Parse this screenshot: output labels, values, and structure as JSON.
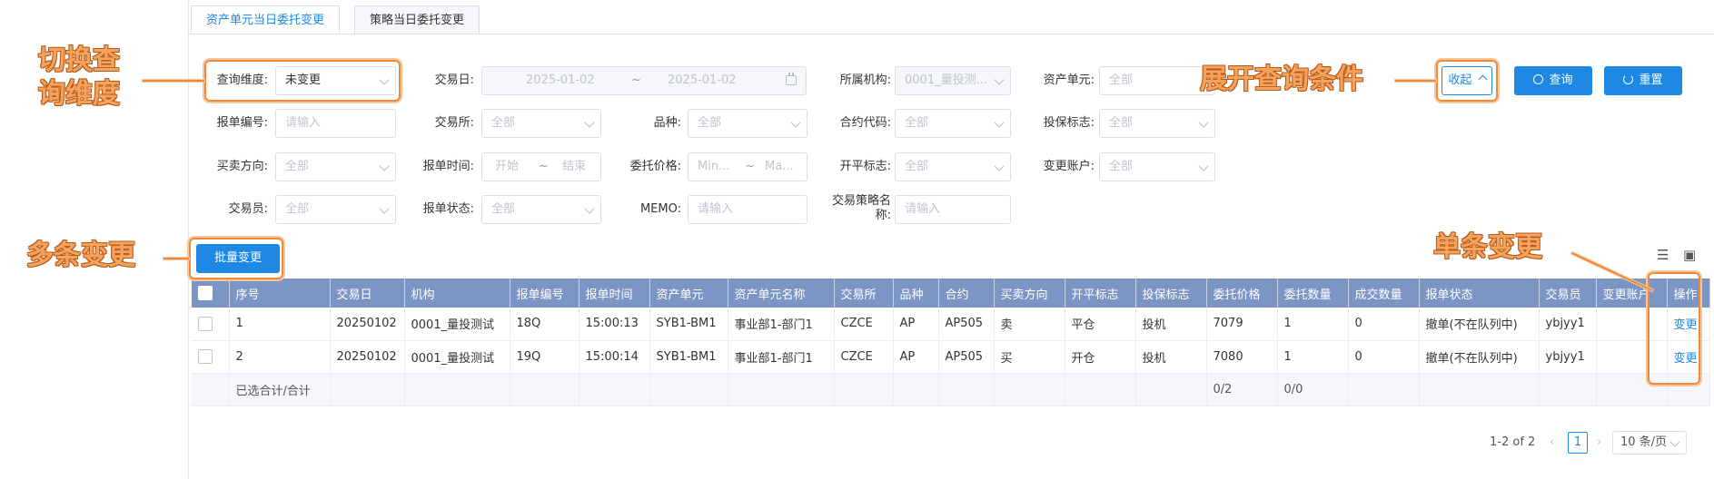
{
  "tabs": [
    {
      "label": "资产单元当日委托变更",
      "active": true
    },
    {
      "label": "策略当日委托变更",
      "active": false
    }
  ],
  "filters": {
    "query_dim": {
      "label": "查询维度:",
      "value": "未变更"
    },
    "trade_date": {
      "label": "交易日:",
      "start": "2025-01-02",
      "sep": "~",
      "end": "2025-01-02"
    },
    "org": {
      "label": "所属机构:",
      "value": "0001_量投测..."
    },
    "asset_unit": {
      "label": "资产单元:",
      "placeholder": "全部"
    },
    "order_no": {
      "label": "报单编号:",
      "placeholder": "请输入"
    },
    "exchange": {
      "label": "交易所:",
      "placeholder": "全部"
    },
    "variety": {
      "label": "品种:",
      "placeholder": "全部"
    },
    "contract": {
      "label": "合约代码:",
      "placeholder": "全部"
    },
    "hedge": {
      "label": "投保标志:",
      "placeholder": "全部"
    },
    "direction": {
      "label": "买卖方向:",
      "placeholder": "全部"
    },
    "order_time": {
      "label": "报单时间:",
      "start": "开始",
      "sep": "~",
      "end": "结束"
    },
    "price": {
      "label": "委托价格:",
      "min": "Min...",
      "sep": "~",
      "max": "Ma..."
    },
    "offset": {
      "label": "开平标志:",
      "placeholder": "全部"
    },
    "change_account": {
      "label": "变更账户:",
      "placeholder": "全部"
    },
    "trader": {
      "label": "交易员:",
      "placeholder": "全部"
    },
    "order_status": {
      "label": "报单状态:",
      "placeholder": "全部"
    },
    "memo": {
      "label": "MEMO:",
      "placeholder": "请输入"
    },
    "strategy": {
      "label_l1": "交易策略名",
      "label_l2": "称:",
      "placeholder": "请输入"
    }
  },
  "buttons": {
    "collapse": "收起",
    "query": "查询",
    "reset": "重置",
    "batch": "批量变更"
  },
  "table": {
    "headers": [
      "序号",
      "交易日",
      "机构",
      "报单编号",
      "报单时间",
      "资产单元",
      "资产单元名称",
      "交易所",
      "品种",
      "合约",
      "买卖方向",
      "开平标志",
      "投保标志",
      "委托价格",
      "委托数量",
      "成交数量",
      "报单状态",
      "交易员",
      "变更账户",
      "操作"
    ],
    "rows": [
      [
        "1",
        "20250102",
        "0001_量投测试",
        "18Q",
        "15:00:13",
        "SYB1-BM1",
        "事业部1-部门1",
        "CZCE",
        "AP",
        "AP505",
        "卖",
        "平仓",
        "投机",
        "7079",
        "1",
        "0",
        "撤单(不在队列中)",
        "ybjyy1",
        "",
        "变更"
      ],
      [
        "2",
        "20250102",
        "0001_量投测试",
        "19Q",
        "15:00:14",
        "SYB1-BM1",
        "事业部1-部门1",
        "CZCE",
        "AP",
        "AP505",
        "买",
        "开仓",
        "投机",
        "7080",
        "1",
        "0",
        "撤单(不在队列中)",
        "ybjyy1",
        "",
        "变更"
      ]
    ],
    "summary": {
      "label": "已选合计/合计",
      "order_qty": "0/2",
      "fill_qty": "0/0"
    }
  },
  "pagination": {
    "range": "1-2 of 2",
    "current": "1",
    "page_size": "10 条/页"
  },
  "annotations": {
    "switch_dim_l1": "切换查",
    "switch_dim_l2": "询维度",
    "expand": "展开查询条件",
    "multi": "多条变更",
    "single": "单条变更"
  },
  "colors": {
    "accent": "#1e88e5",
    "table_header": "#7b96c4",
    "annotation": "#ef8a3c"
  }
}
